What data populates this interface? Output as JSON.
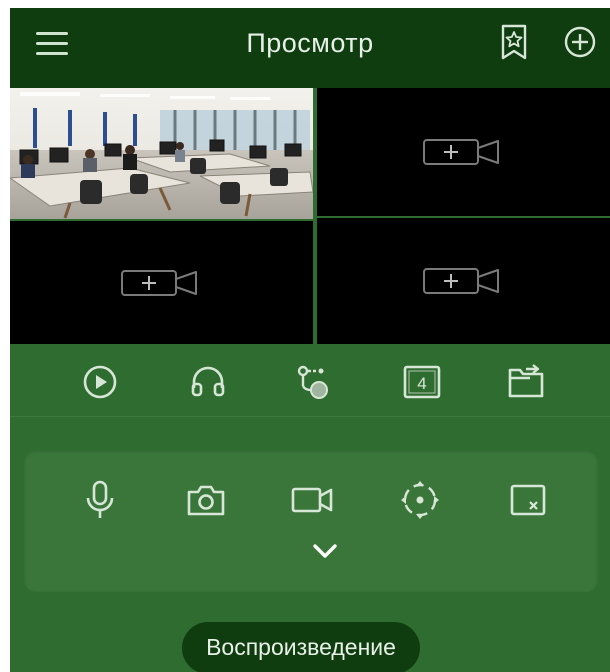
{
  "header": {
    "title": "Просмотр",
    "menu_icon": "hamburger-menu-icon",
    "bookmark_icon": "bookmark-star-icon",
    "add_icon": "add-circle-icon"
  },
  "grid": {
    "layout": "2x2",
    "cells": [
      {
        "state": "live",
        "content": "office-camera-feed"
      },
      {
        "state": "empty",
        "icon": "add-camera-icon"
      },
      {
        "state": "empty",
        "icon": "add-camera-icon"
      },
      {
        "state": "empty",
        "icon": "add-camera-icon"
      }
    ]
  },
  "toolbar_primary": [
    {
      "name": "play",
      "icon": "play-circle-icon"
    },
    {
      "name": "audio",
      "icon": "headphones-icon"
    },
    {
      "name": "ptz",
      "icon": "ptz-joystick-icon"
    },
    {
      "name": "layout",
      "icon": "layout-4-icon",
      "label": "4"
    },
    {
      "name": "folder",
      "icon": "folder-share-icon"
    }
  ],
  "toolbar_secondary": [
    {
      "name": "microphone",
      "icon": "microphone-icon"
    },
    {
      "name": "snapshot",
      "icon": "camera-icon"
    },
    {
      "name": "record",
      "icon": "video-camera-icon"
    },
    {
      "name": "ptz-control",
      "icon": "ptz-direction-icon"
    },
    {
      "name": "close-all",
      "icon": "close-window-icon"
    }
  ],
  "expand_icon": "chevron-down-icon",
  "playback_button": {
    "label": "Воспроизведение"
  },
  "colors": {
    "header_bg": "#0f3d10",
    "body_bg": "#2f6c2f",
    "panel_bg": "#3a763a",
    "icon": "#d8e6d8"
  }
}
